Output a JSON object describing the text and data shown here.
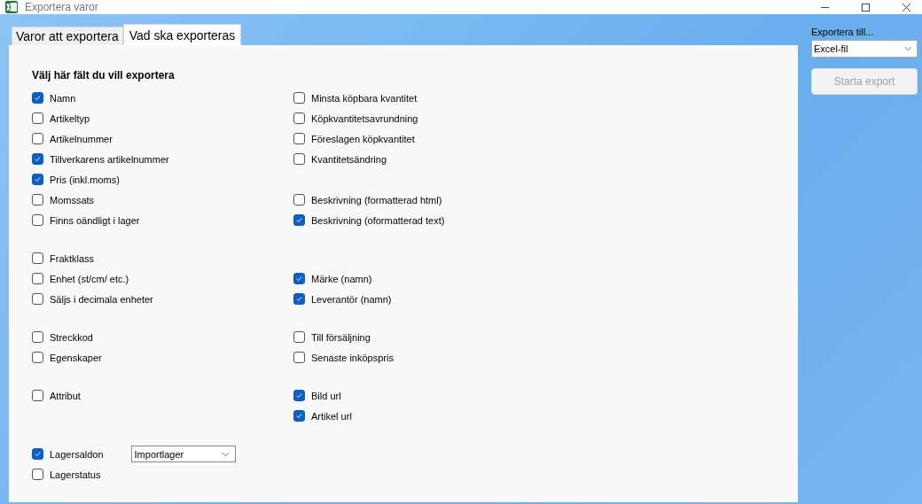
{
  "window": {
    "title": "Exportera varor"
  },
  "tabs": [
    {
      "label": "Varor att  exportera",
      "selected": false
    },
    {
      "label": "Vad ska exporteras",
      "selected": true
    }
  ],
  "heading": "Välj här fält du vill exportera",
  "groups": [
    [
      {
        "left": {
          "label": "Namn",
          "checked": true
        },
        "right": {
          "label": "Minsta köpbara kvantitet",
          "checked": false
        }
      },
      {
        "left": {
          "label": "Artikeltyp",
          "checked": false
        },
        "right": {
          "label": "Köpkvantitetsavrundning",
          "checked": false
        }
      },
      {
        "left": {
          "label": "Artikelnummer",
          "checked": false
        },
        "right": {
          "label": "Föreslagen köpkvantitet",
          "checked": false
        }
      },
      {
        "left": {
          "label": "Tillverkarens artikelnummer",
          "checked": true
        },
        "right": {
          "label": "Kvantitetsändring",
          "checked": false
        }
      },
      {
        "left": {
          "label": "Pris (inkl.moms)",
          "checked": true
        }
      },
      {
        "left": {
          "label": "Momssats",
          "checked": false
        },
        "right": {
          "label": "Beskrivning (formatterad html)",
          "checked": false
        }
      },
      {
        "left": {
          "label": "Finns oändligt i lager",
          "checked": false
        },
        "right": {
          "label": "Beskrivning (oformatterad text)",
          "checked": true
        }
      }
    ],
    [
      {
        "left": {
          "label": "Fraktklass",
          "checked": false
        }
      },
      {
        "left": {
          "label": "Enhet (st/cm/ etc.)",
          "checked": false
        },
        "right": {
          "label": "Märke (namn)",
          "checked": true
        }
      },
      {
        "left": {
          "label": "Säljs i decimala enheter",
          "checked": false
        },
        "right": {
          "label": "Leverantör (namn)",
          "checked": true
        }
      }
    ],
    [
      {
        "left": {
          "label": "Streckkod",
          "checked": false
        },
        "right": {
          "label": "Till försäljning",
          "checked": false
        }
      },
      {
        "left": {
          "label": "Egenskaper",
          "checked": false
        },
        "right": {
          "label": "Senaste inköpspris",
          "checked": false
        }
      }
    ],
    [
      {
        "left": {
          "label": "Attribut",
          "checked": false
        },
        "right": {
          "label": "Bild url",
          "checked": true
        }
      },
      {
        "right": {
          "label": "Artikel url",
          "checked": true
        }
      }
    ],
    [
      {
        "left": {
          "label": "Lagersaldon",
          "checked": true,
          "dropdown": "Importlager"
        }
      },
      {
        "left": {
          "label": "Lagerstatus",
          "checked": false
        }
      }
    ]
  ],
  "export": {
    "label": "Exportera till...",
    "format": "Excel-fil",
    "button": "Starta export",
    "button_disabled": true
  }
}
